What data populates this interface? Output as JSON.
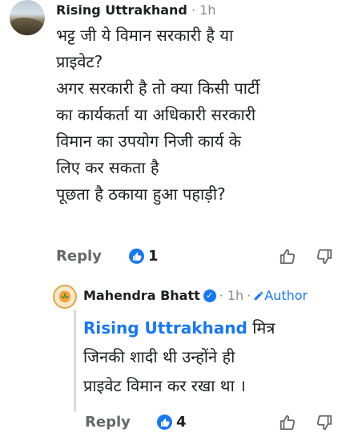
{
  "comment1": {
    "author": "Rising Uttrakhand",
    "time": "1h",
    "lines": [
      "भट्ट जी ये विमान सरकारी है या",
      "प्राइवेट?",
      "अगर सरकारी है तो क्या किसी पार्टी",
      "का कार्यकर्ता या अधिकारी सरकारी",
      "विमान का उपयोग निजी कार्य के",
      "लिए कर सकता है",
      "पूछता है ठकाया हुआ पहाड़ी?"
    ],
    "reply_label": "Reply",
    "reaction_count": "1"
  },
  "comment2": {
    "author": "Mahendra Bhatt",
    "time": "1h",
    "author_badge": "Author",
    "mention": "Rising Uttrakhand",
    "line1_rest": "मित्र",
    "lines": [
      "जिनकी शादी थी उन्होंने ही",
      "प्राइवेट विमान कर रखा था ।"
    ],
    "reply_label": "Reply",
    "reaction_count": "4"
  },
  "separator": "·",
  "icons": [
    "like-icon",
    "thumbs-up-outline-icon",
    "thumbs-down-outline-icon",
    "verified-badge-icon",
    "pencil-icon"
  ],
  "colors": {
    "accent": "#1877f2",
    "muted": "#65676b",
    "text": "#1c1e21"
  }
}
